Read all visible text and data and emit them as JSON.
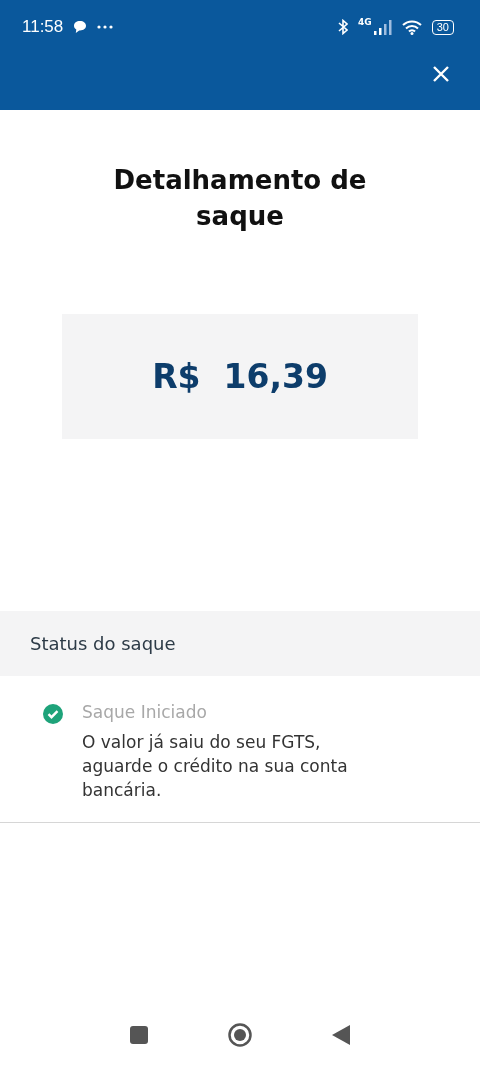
{
  "status_bar": {
    "time": "11:58",
    "network": "4G",
    "battery": "30"
  },
  "title": "Detalhamento de saque",
  "amount": "R$  16,39",
  "status_section": {
    "heading": "Status do saque",
    "steps": [
      {
        "label": "Saque Iniciado",
        "description": "O valor já saiu do seu FGTS, aguarde o crédito na sua conta bancária.",
        "done": true
      }
    ]
  }
}
